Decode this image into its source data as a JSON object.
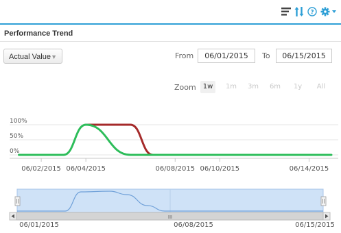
{
  "toolbar": {
    "icons": [
      "list-icon",
      "sort-icon",
      "help-icon",
      "gear-icon"
    ]
  },
  "panel": {
    "title": "Performance Trend"
  },
  "metric_select": {
    "selected": "Actual Value"
  },
  "range": {
    "from_label": "From",
    "from_value": "06/01/2015",
    "to_label": "To",
    "to_value": "06/15/2015"
  },
  "zoom": {
    "label": "Zoom",
    "buttons": [
      {
        "label": "1w",
        "active": true
      },
      {
        "label": "1m",
        "active": false
      },
      {
        "label": "3m",
        "active": false
      },
      {
        "label": "6m",
        "active": false
      },
      {
        "label": "1y",
        "active": false
      },
      {
        "label": "All",
        "active": false
      }
    ]
  },
  "colors": {
    "accent": "#2e9fd6",
    "series_green": "#2dbd5a",
    "series_red": "#a52a2a",
    "navigator_fill": "#cfe2f7",
    "navigator_line": "#6fa0d8"
  },
  "chart_data": {
    "type": "line",
    "ylim": [
      0,
      100
    ],
    "yticks": [
      "0%",
      "50%",
      "100%"
    ],
    "x_tick_labels": [
      "06/02/2015",
      "06/04/2015",
      "06/08/2015",
      "06/10/2015",
      "06/14/2015"
    ],
    "series": [
      {
        "color": "#2dbd5a",
        "points": [
          [
            "06/01/2015",
            0
          ],
          [
            "06/03/2015",
            0
          ],
          [
            "06/04/2015",
            100
          ],
          [
            "06/06/2015",
            0
          ],
          [
            "06/15/2015",
            0
          ]
        ]
      },
      {
        "color": "#a52a2a",
        "points": [
          [
            "06/04/2015",
            100
          ],
          [
            "06/05/2015",
            100
          ],
          [
            "06/06/2015",
            100
          ],
          [
            "06/07/2015",
            0
          ]
        ]
      }
    ]
  },
  "navigator": {
    "tick_labels": [
      "06/01/2015",
      "06/08/2015",
      "06/15/2015"
    ],
    "scroll_center_mark": "III"
  }
}
